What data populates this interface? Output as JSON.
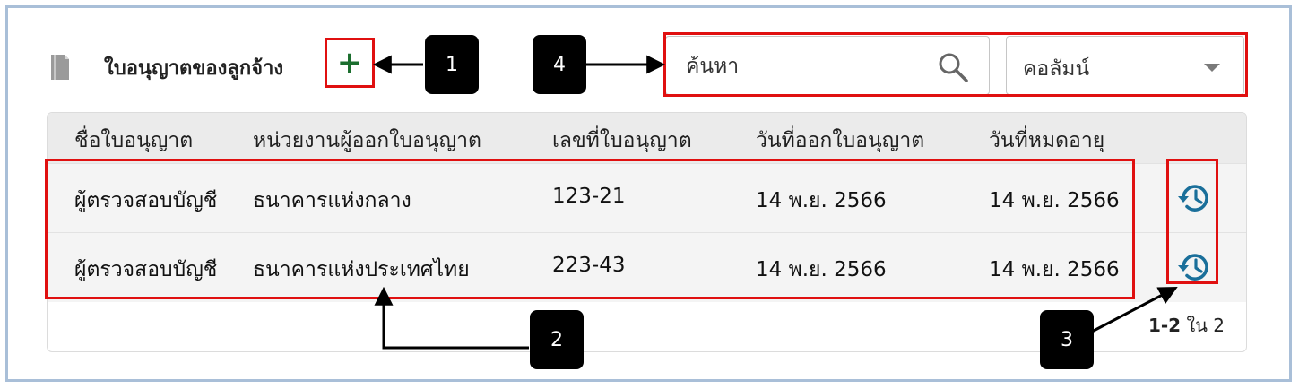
{
  "header": {
    "title": "ใบอนุญาตของลูกจ้าง",
    "add_label": "+"
  },
  "search": {
    "placeholder": "ค้นหา",
    "value": ""
  },
  "column_select": {
    "selected": "คอลัมน์"
  },
  "table": {
    "columns": [
      "ชื่อใบอนุญาต",
      "หน่วยงานผู้ออกใบอนุญาต",
      "เลขที่ใบอนุญาต",
      "วันที่ออกใบอนุญาต",
      "วันที่หมดอายุ"
    ],
    "rows": [
      [
        "ผู้ตรวจสอบบัญชี",
        "ธนาคารแห่งกลาง",
        "123-21",
        "14 พ.ย. 2566",
        "14 พ.ย. 2566"
      ],
      [
        "ผู้ตรวจสอบบัญชี",
        "ธนาคารแห่งประเทศไทย",
        "223-43",
        "14 พ.ย. 2566",
        "14 พ.ย. 2566"
      ]
    ]
  },
  "pager": {
    "range": "1-2",
    "of_text": "ใน 2"
  },
  "callouts": [
    "1",
    "2",
    "3",
    "4"
  ],
  "icons": {
    "header": "document-icon",
    "search": "search-icon",
    "history": "history-icon",
    "dropdown": "chevron-down-icon"
  },
  "colors": {
    "accent_green": "#1b6e2e",
    "history_teal": "#1a6f9a",
    "highlight_red": "#e01010",
    "frame_blue": "#a9bfd8"
  }
}
